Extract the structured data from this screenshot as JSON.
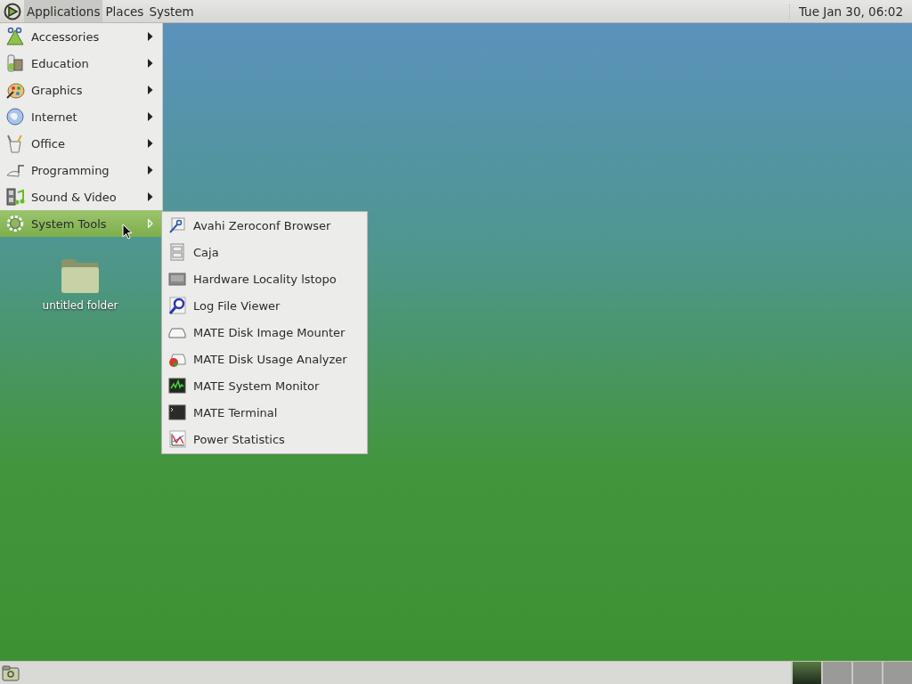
{
  "top_panel": {
    "menus": [
      {
        "label": "Applications",
        "selected": true
      },
      {
        "label": "Places",
        "selected": false
      },
      {
        "label": "System",
        "selected": false
      }
    ],
    "clock": "Tue Jan 30, 06:02"
  },
  "applications_menu": {
    "items": [
      {
        "label": "Accessories",
        "selected": false
      },
      {
        "label": "Education",
        "selected": false
      },
      {
        "label": "Graphics",
        "selected": false
      },
      {
        "label": "Internet",
        "selected": false
      },
      {
        "label": "Office",
        "selected": false
      },
      {
        "label": "Programming",
        "selected": false
      },
      {
        "label": "Sound & Video",
        "selected": false
      },
      {
        "label": "System Tools",
        "selected": true
      }
    ]
  },
  "submenu": {
    "items": [
      {
        "label": "Avahi Zeroconf Browser"
      },
      {
        "label": "Caja"
      },
      {
        "label": "Hardware Locality lstopo"
      },
      {
        "label": "Log File Viewer"
      },
      {
        "label": "MATE Disk Image Mounter"
      },
      {
        "label": "MATE Disk Usage Analyzer"
      },
      {
        "label": "MATE System Monitor"
      },
      {
        "label": "MATE Terminal"
      },
      {
        "label": "Power Statistics"
      }
    ]
  },
  "desktop_icons": [
    {
      "label": "untitled folder"
    }
  ],
  "bottom_panel": {
    "workspaces": [
      {
        "selected": true
      },
      {
        "selected": false
      },
      {
        "selected": false
      },
      {
        "selected": false
      }
    ]
  }
}
